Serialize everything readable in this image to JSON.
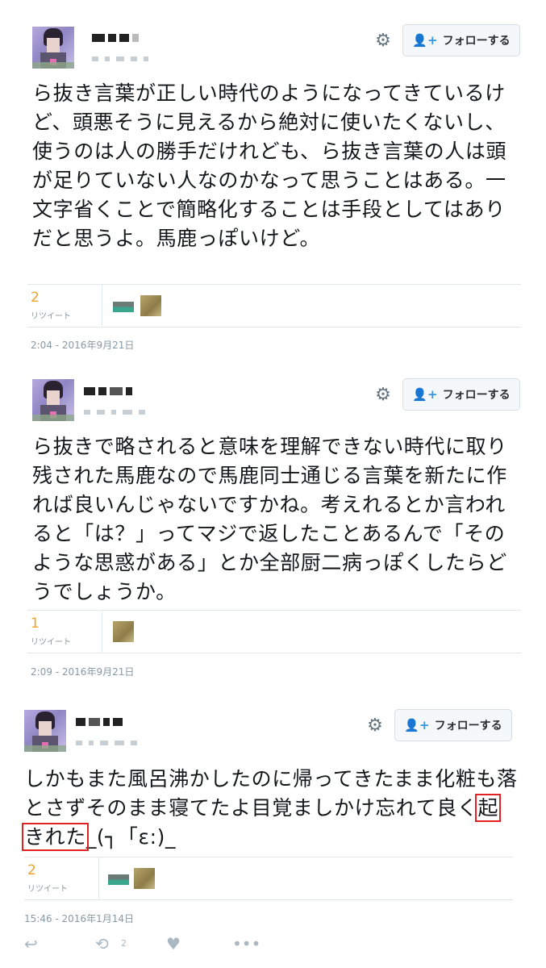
{
  "follow_label": "フォローする",
  "retweet_label": "リツイート",
  "tweets": [
    {
      "text": "ら抜き言葉が正しい時代のようになってきているけど、頭悪そうに見えるから絶対に使いたくないし、使うのは人の勝手だけれども、ら抜き言葉の人は頭が足りていない人なのかなって思うことはある。一文字省くことで簡略化することは手段としてはありだと思うよ。馬鹿っぽいけど。",
      "retweets": "2",
      "timestamp": "2:04 - 2016年9月21日"
    },
    {
      "text": "ら抜きで略されると意味を理解できない時代に取り残された馬鹿なので馬鹿同士通じる言葉を新たに作れば良いんじゃないですかね。考えれるとか言われると「は？」ってマジで返したことあるんで「そのような思惑がある」とか全部厨二病っぽくしたらどうでしょうか。",
      "retweets": "1",
      "timestamp": "2:09 - 2016年9月21日"
    },
    {
      "text_before": "しかもまた風呂沸かしたのに帰ってきたまま化粧も落とさずそのまま寝てたよ目覚ましかけ忘れて良く",
      "text_highlight": "起きれた",
      "text_after": "_(┐「ε:)_",
      "retweets": "2",
      "timestamp": "15:46 - 2016年1月14日",
      "retweet_action_count": "2"
    }
  ],
  "icons": {
    "gear": "gear-icon",
    "follow": "add-user-icon",
    "reply": "reply-icon",
    "retweet": "retweet-icon",
    "like": "heart-icon",
    "more": "more-icon"
  },
  "colors": {
    "retweet_count": "#f0a22b",
    "highlight_border": "#e02222",
    "follow_icon": "#3b94d9"
  }
}
